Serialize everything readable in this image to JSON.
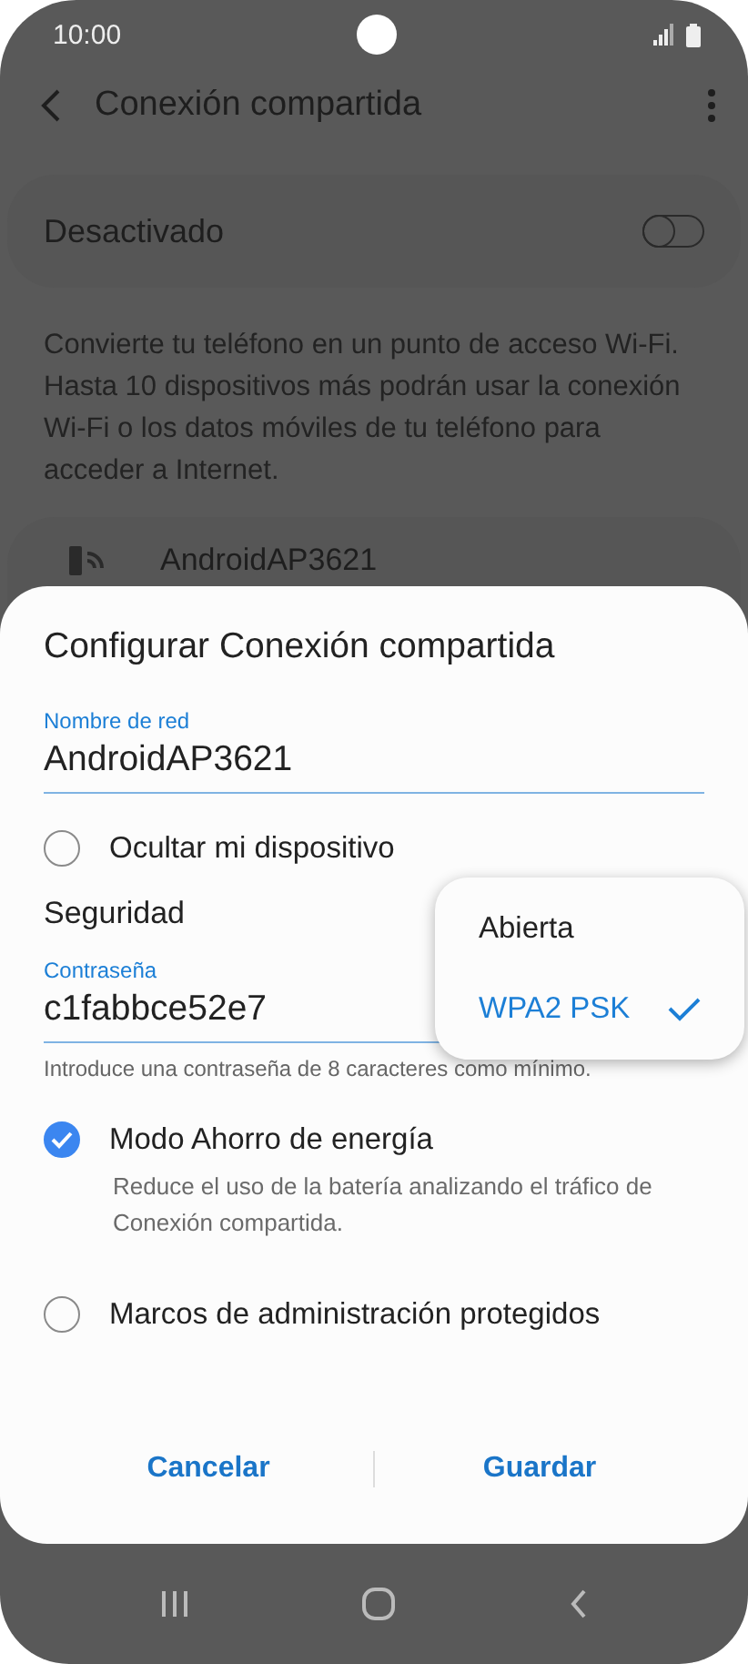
{
  "status_bar": {
    "time": "10:00"
  },
  "header": {
    "title": "Conexión compartida"
  },
  "master_switch": {
    "label": "Desactivado",
    "on": false
  },
  "description": "Convierte tu teléfono en un punto de acceso Wi-Fi. Hasta 10 dispositivos más podrán usar la conexión Wi-Fi o los datos móviles de tu teléfono para acceder a Internet.",
  "network_card": {
    "name": "AndroidAP3621"
  },
  "dialog": {
    "title": "Configurar Conexión compartida",
    "network_name": {
      "label": "Nombre de red",
      "value": "AndroidAP3621"
    },
    "hide_device": {
      "label": "Ocultar mi dispositivo",
      "checked": false
    },
    "security": {
      "label": "Seguridad",
      "options": [
        {
          "label": "Abierta",
          "selected": false
        },
        {
          "label": "WPA2 PSK",
          "selected": true
        }
      ]
    },
    "password": {
      "label": "Contraseña",
      "value": "c1fabbce52e7",
      "hint": "Introduce una contraseña de 8 caracteres como mínimo."
    },
    "checkboxes": [
      {
        "label": "Modo Ahorro de energía",
        "checked": true,
        "description": "Reduce el uso de la batería analizando el tráfico de Conexión compartida."
      },
      {
        "label": "Marcos de administración protegidos",
        "checked": false
      }
    ],
    "buttons": [
      "Cancelar",
      "Guardar"
    ]
  }
}
